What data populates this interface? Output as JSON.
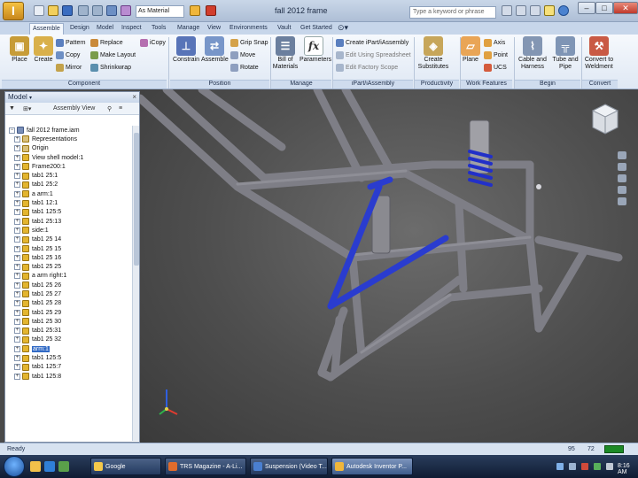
{
  "app": {
    "file_title": "fall 2012 frame",
    "material": "As Material",
    "search_placeholder": "Type a keyword or phrase",
    "window_controls": {
      "minimize": "–",
      "maximize": "□",
      "close": "✕"
    }
  },
  "ribbon_tabs": [
    "Assemble",
    "Design",
    "Model",
    "Inspect",
    "Tools",
    "Manage",
    "View",
    "Environments",
    "Vault",
    "Get Started"
  ],
  "ribbon": {
    "component": {
      "label": "Component",
      "place": "Place",
      "create": "Create",
      "pattern": "Pattern",
      "copy": "Copy",
      "mirror": "Mirror",
      "replace": "Replace",
      "make_layout": "Make Layout",
      "shrinkwrap": "Shrinkwrap",
      "icopy": "iCopy"
    },
    "position": {
      "label": "Position",
      "constrain": "Constrain",
      "assemble": "Assemble",
      "grip_snap": "Grip Snap",
      "move": "Move",
      "rotate": "Rotate"
    },
    "manage": {
      "label": "Manage",
      "bom": "Bill of Materials",
      "parameters": "Parameters"
    },
    "ipart": {
      "label": "iPart/iAssembly",
      "create": "Create iPart/iAssembly",
      "edit_spreadsheet": "Edit Using Spreadsheet",
      "edit_factory": "Edit Factory Scope"
    },
    "productivity": {
      "label": "Productivity",
      "create_substitutes": "Create Substitutes"
    },
    "work_features": {
      "label": "Work Features",
      "plane": "Plane",
      "axis": "Axis",
      "point": "Point",
      "ucs": "UCS"
    },
    "begin": {
      "label": "Begin",
      "cable_harness": "Cable and Harness",
      "tube_pipe": "Tube and Pipe"
    },
    "convert": {
      "label": "Convert",
      "to_weldment": "Convert to Weldment"
    }
  },
  "browser": {
    "title": "Model",
    "close": "×",
    "filter_label": "Assembly View",
    "tree": [
      {
        "label": "fall 2012 frame.iam",
        "kind": "top",
        "expand": "−"
      },
      {
        "label": "Representations",
        "kind": "folder",
        "expand": "+"
      },
      {
        "label": "Origin",
        "kind": "folder",
        "expand": "+"
      },
      {
        "label": "View shell model:1",
        "kind": "part",
        "expand": "+"
      },
      {
        "label": "Frame200:1",
        "kind": "part",
        "expand": "+"
      },
      {
        "label": "tab1 25:1",
        "kind": "part",
        "expand": "+"
      },
      {
        "label": "tab1 25:2",
        "kind": "part",
        "expand": "+"
      },
      {
        "label": "a arm:1",
        "kind": "part",
        "expand": "+"
      },
      {
        "label": "tab1 12:1",
        "kind": "part",
        "expand": "+"
      },
      {
        "label": "tab1 125:5",
        "kind": "part",
        "expand": "+"
      },
      {
        "label": "tab1 25:13",
        "kind": "part",
        "expand": "+"
      },
      {
        "label": "side:1",
        "kind": "part",
        "expand": "+"
      },
      {
        "label": "tab1 25 14",
        "kind": "part",
        "expand": "+"
      },
      {
        "label": "tab1 25 15",
        "kind": "part",
        "expand": "+"
      },
      {
        "label": "tab1 25 16",
        "kind": "part",
        "expand": "+"
      },
      {
        "label": "tab1 25 25",
        "kind": "part",
        "expand": "+"
      },
      {
        "label": "a arm right:1",
        "kind": "part",
        "expand": "+"
      },
      {
        "label": "tab1 25 26",
        "kind": "part",
        "expand": "+"
      },
      {
        "label": "tab1 25 27",
        "kind": "part",
        "expand": "+"
      },
      {
        "label": "tab1 25 28",
        "kind": "part",
        "expand": "+"
      },
      {
        "label": "tab1 25 29",
        "kind": "part",
        "expand": "+"
      },
      {
        "label": "tab1 25 30",
        "kind": "part",
        "expand": "+"
      },
      {
        "label": "tab1 25:31",
        "kind": "part",
        "expand": "+"
      },
      {
        "label": "tab1 25 32",
        "kind": "part",
        "expand": "+"
      },
      {
        "label": "arm:1",
        "kind": "part",
        "expand": "+",
        "selected": true
      },
      {
        "label": "tab1 125:5",
        "kind": "part",
        "expand": "+"
      },
      {
        "label": "tab1 125:7",
        "kind": "part",
        "expand": "+"
      },
      {
        "label": "tab1 125:8",
        "kind": "part",
        "expand": "+"
      }
    ]
  },
  "status": {
    "text": "Ready",
    "n1": "95",
    "n2": "72"
  },
  "taskbar": {
    "buttons": [
      "Google",
      "TRS Magazine - A-Li...",
      "Suspension (Video T...",
      "Autodesk Inventor P..."
    ],
    "clock": "8:16 AM"
  },
  "colors": {
    "frame": "#8e8e96",
    "arm": "#2a3ccf",
    "spring": "#2230c8"
  }
}
